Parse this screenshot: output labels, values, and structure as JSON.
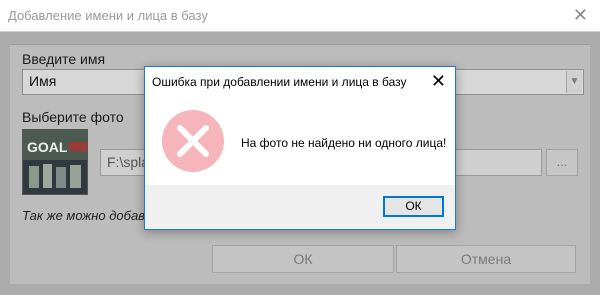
{
  "main_window": {
    "title": "Добавление имени и лица в базу",
    "close_glyph": "✕",
    "name_label": "Введите имя",
    "name_value": "Имя",
    "photo_label": "Выберите фото",
    "thumbnail_text": "GOAL",
    "path_value": "F:\\spla",
    "browse_label": "...",
    "hint_text": "Так же можно добав",
    "ok_label": "ОК",
    "cancel_label": "Отмена"
  },
  "dialog": {
    "title": "Ошибка при добавлении имени и лица в базу",
    "close_glyph": "✕",
    "icon": "error-icon",
    "message": "На фото не найдено ни одного лица!",
    "ok_label": "ОК",
    "icon_color": "#f6b5bb"
  }
}
